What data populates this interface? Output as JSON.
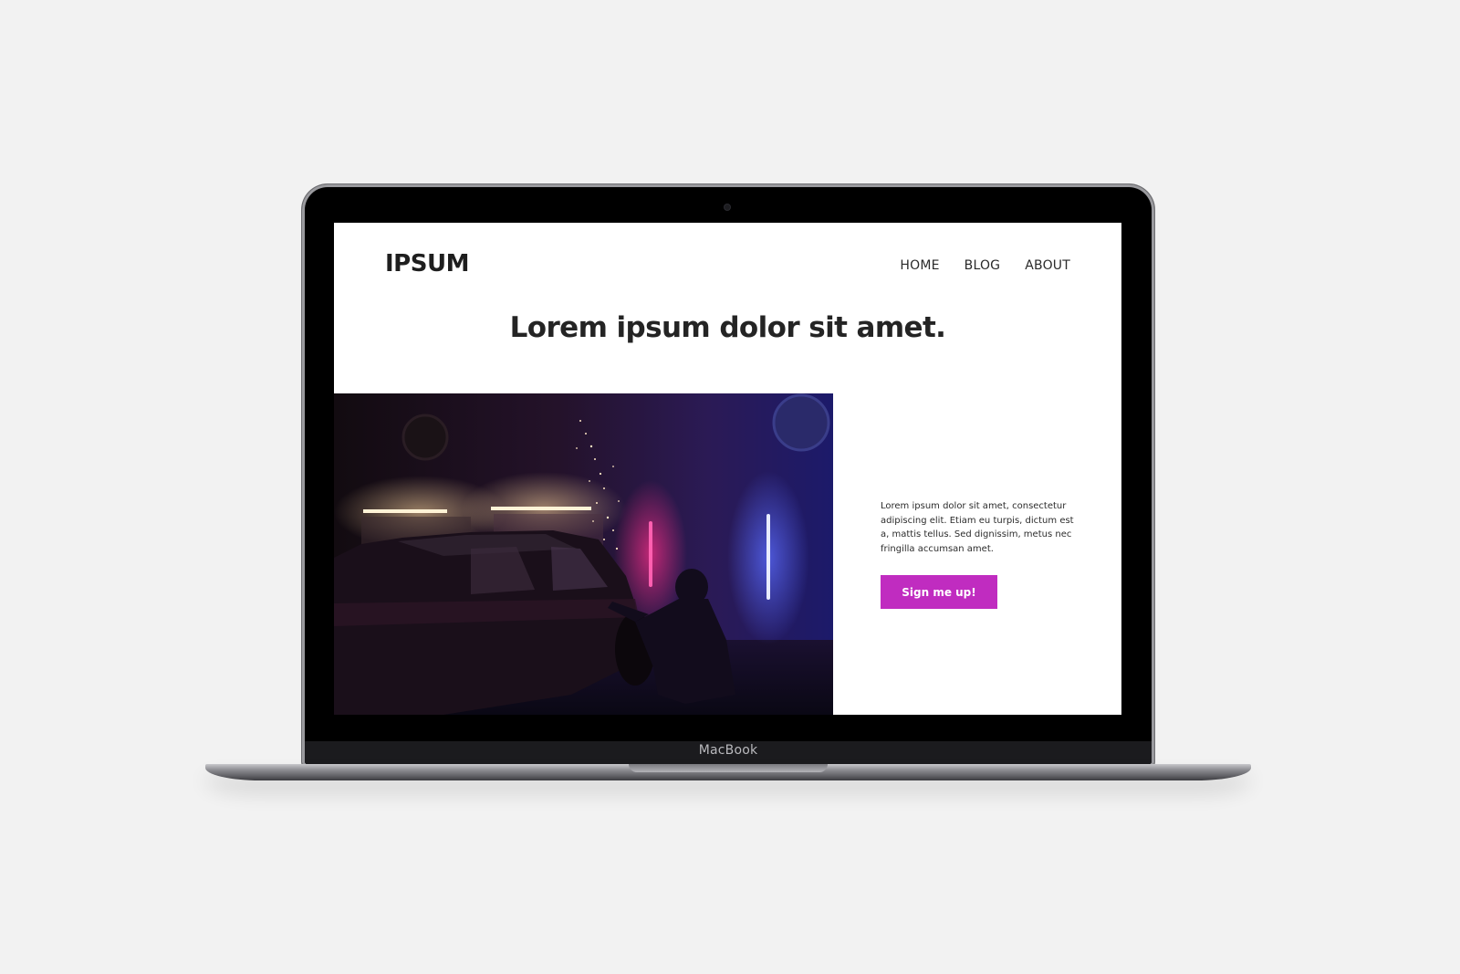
{
  "device": {
    "brand_label": "MacBook"
  },
  "site": {
    "logo": "IPSUM",
    "nav": [
      {
        "label": "HOME"
      },
      {
        "label": "BLOG"
      },
      {
        "label": "ABOUT"
      }
    ],
    "hero_title": "Lorem ipsum dolor sit amet.",
    "body_text": "Lorem ipsum dolor sit amet, consectetur adipiscing elit. Etiam eu turpis, dictum est a, mattis tellus. Sed dignissim, metus nec fringilla accumsan amet.",
    "cta_label": "Sign me up!"
  },
  "colors": {
    "accent": "#c02cc0",
    "page_background": "#f2f2f2",
    "screen_background": "#ffffff",
    "text_dark": "#242424"
  }
}
